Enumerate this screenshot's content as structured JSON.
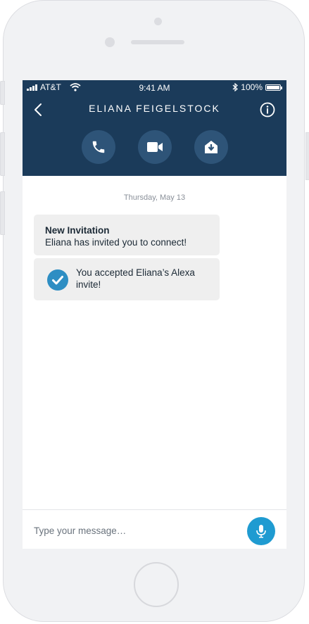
{
  "status_bar": {
    "carrier": "AT&T",
    "time": "9:41 AM",
    "battery": "100%"
  },
  "header": {
    "contact_name": "ELIANA FEIGELSTOCK"
  },
  "actions": [
    {
      "icon": "phone-icon"
    },
    {
      "icon": "video-camera-icon"
    },
    {
      "icon": "drop-in-icon"
    }
  ],
  "conversation": {
    "date": "Thursday, May 13",
    "invitation": {
      "title": "New Invitation",
      "body": "Eliana has invited you to connect!"
    },
    "accepted": {
      "line1": "You accepted Eliana’s Alexa",
      "line2": "invite!"
    }
  },
  "composer": {
    "placeholder": "Type your message…"
  },
  "colors": {
    "header": "#1b3b5a",
    "action_button": "#2e5478",
    "accent": "#1f9bd1",
    "bubble": "#efefef"
  }
}
